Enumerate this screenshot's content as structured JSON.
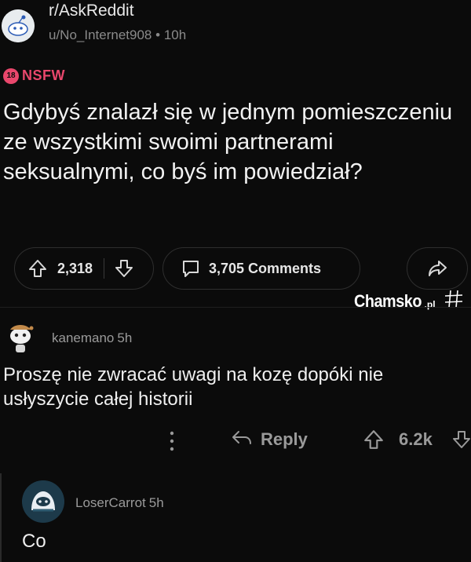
{
  "post": {
    "subreddit": "r/AskReddit",
    "username": "u/No_Internet908",
    "meta_sep": "•",
    "time": "10h",
    "nsfw_badge": "18",
    "nsfw_label": "NSFW",
    "title": "Gdybyś znalazł się w jednym pomieszczeniu ze wszystkimi swoimi partnerami seksualnymi, co byś im powiedział?",
    "votes": "2,318",
    "comments": "3,705 Comments"
  },
  "watermark": {
    "main": "Chamsko",
    "suffix": ".pl"
  },
  "comments": [
    {
      "user": "kanemano",
      "time": "5h",
      "text": "Proszę nie zwracać uwagi na kozę dopóki nie usłyszycie całej historii",
      "reply_label": "Reply",
      "score": "6.2k"
    },
    {
      "user": "LoserCarrot",
      "time": "5h",
      "text": "Co"
    }
  ],
  "colors": {
    "background": "#0b0b0b",
    "nsfw": "#e9476c",
    "muted": "#9a9a9a"
  },
  "icons": [
    "snoo-avatar",
    "upvote-icon",
    "downvote-icon",
    "comment-icon",
    "share-icon",
    "reply-icon",
    "more-icon"
  ]
}
